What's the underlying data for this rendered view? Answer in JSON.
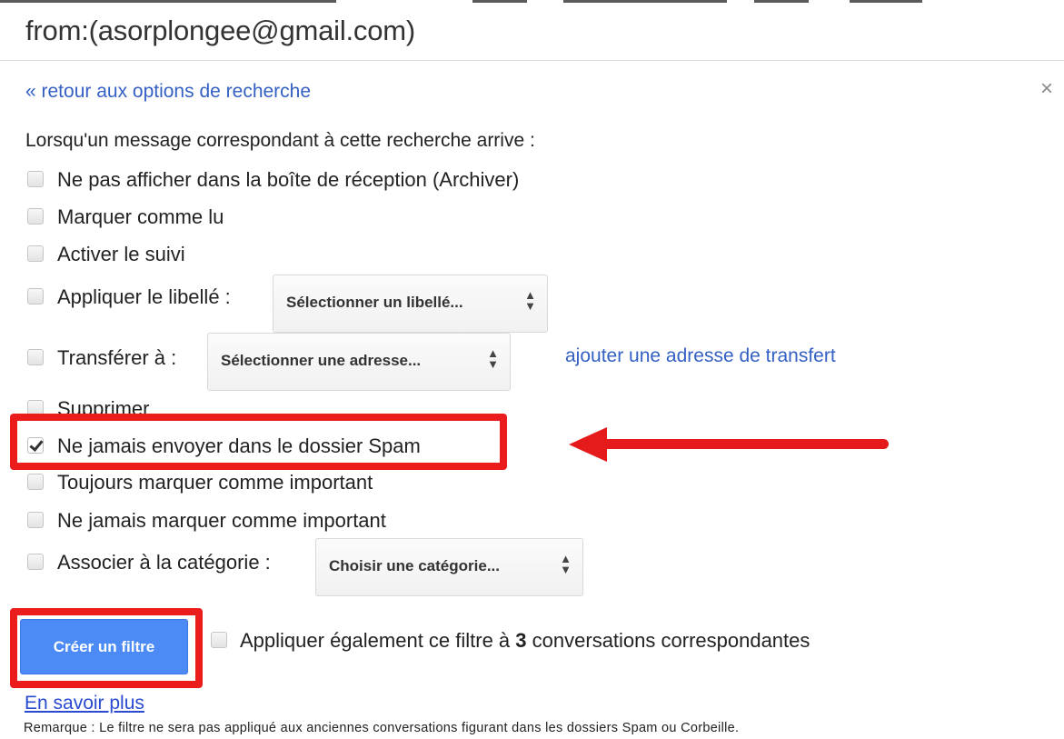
{
  "search_query": "from:(asorplongee@gmail.com)",
  "back_link": "« retour aux options de recherche",
  "close_symbol": "×",
  "intro": "Lorsqu'un message correspondant à cette recherche arrive :",
  "options": {
    "archive": "Ne pas afficher dans la boîte de réception (Archiver)",
    "mark_read": "Marquer comme lu",
    "star": "Activer le suivi",
    "apply_label": "Appliquer le libellé :",
    "forward": "Transférer à :",
    "delete": "Supprimer",
    "never_spam": "Ne jamais envoyer dans le dossier Spam",
    "always_important": "Toujours marquer comme important",
    "never_important": "Ne jamais marquer comme important",
    "categorize": "Associer à la catégorie :"
  },
  "checked": {
    "never_spam": true
  },
  "selects": {
    "label": "Sélectionner un libellé...",
    "address": "Sélectionner une adresse...",
    "category": "Choisir une catégorie..."
  },
  "add_forward_link": "ajouter une adresse de transfert",
  "create_button": "Créer un filtre",
  "apply_existing": {
    "prefix": "Appliquer également ce filtre à ",
    "count": "3",
    "suffix": " conversations correspondantes"
  },
  "learn_more": "En savoir plus",
  "note": "Remarque : Le filtre ne sera pas appliqué aux anciennes conversations figurant dans les dossiers Spam ou Corbeille.",
  "colors": {
    "link": "#3460c4",
    "button_bg": "#4c8bf5",
    "annotation_red": "#ea1c1c"
  },
  "icons": {
    "select_arrows": "up-down-chevron-icon",
    "close": "close-icon",
    "annotation": "red-arrow-annotation"
  }
}
